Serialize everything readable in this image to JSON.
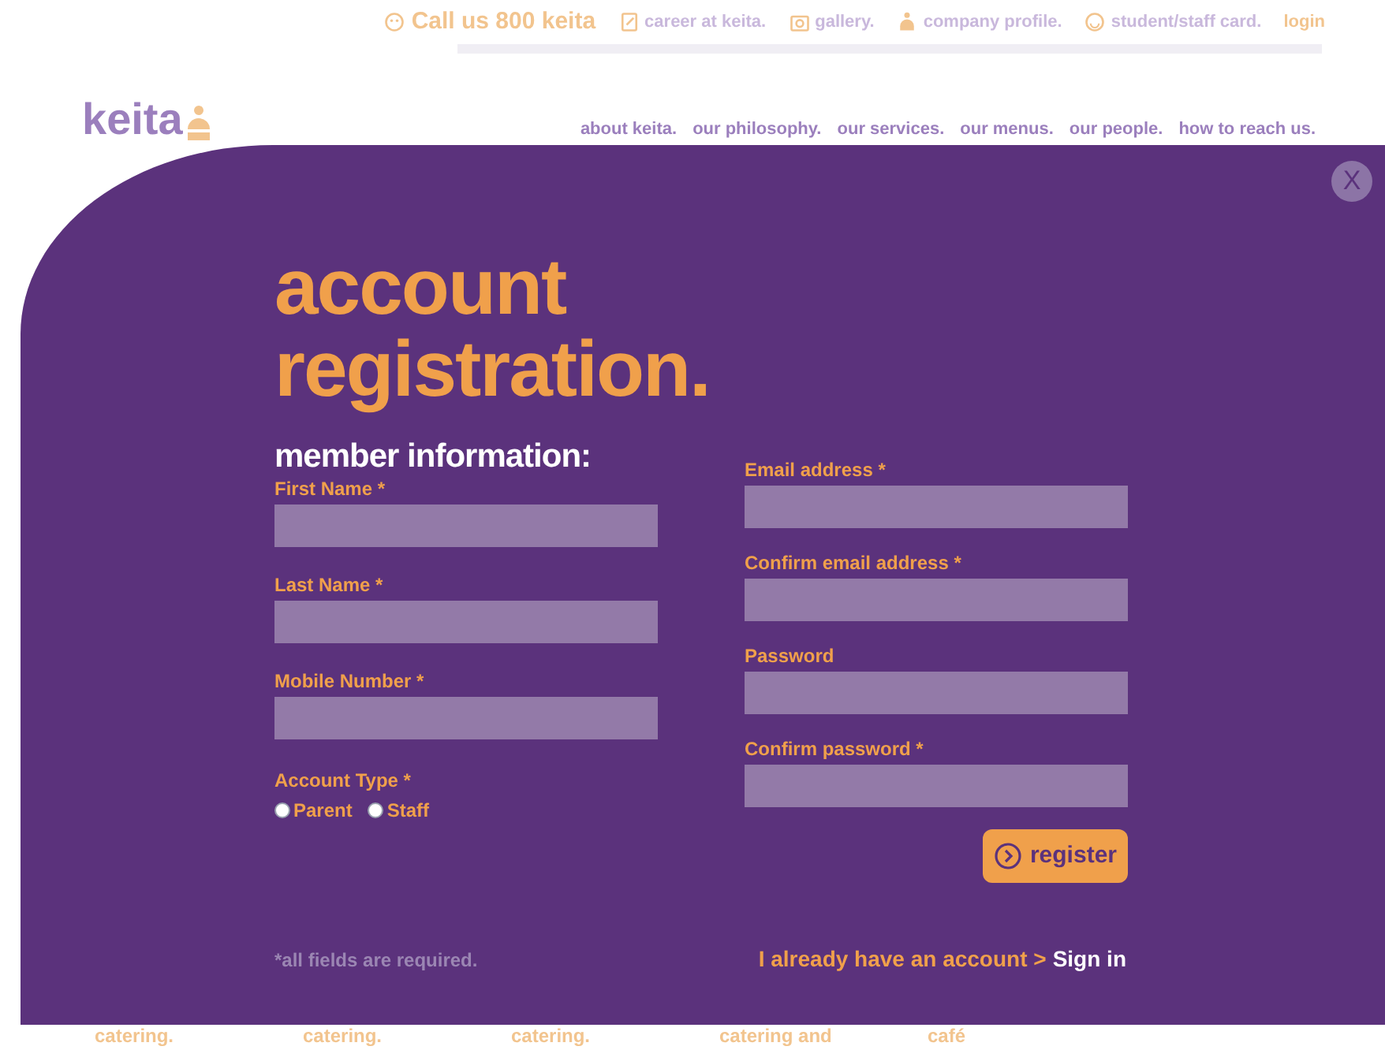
{
  "top_bar": {
    "phone": "Call us 800 keita",
    "links": [
      {
        "label": "career at keita."
      },
      {
        "label": "gallery."
      },
      {
        "label": "company profile."
      },
      {
        "label": "student/staff card."
      }
    ],
    "login": "login"
  },
  "logo": "keita",
  "nav": [
    "about keita.",
    "our philosophy.",
    "our services.",
    "our menus.",
    "our people.",
    "how to reach us."
  ],
  "modal": {
    "close": "X",
    "title_lines": [
      "account",
      "registration."
    ],
    "section_title": "member information:",
    "left_fields": [
      {
        "label": "First Name *"
      },
      {
        "label": "Last Name *"
      },
      {
        "label": "Mobile Number *"
      }
    ],
    "account_type": {
      "label": "Account Type *",
      "options": [
        {
          "label": "Parent",
          "selected": false
        },
        {
          "label": "Staff",
          "selected": false
        }
      ]
    },
    "right_fields": [
      {
        "label": "Email address *"
      },
      {
        "label": "Confirm email address *"
      },
      {
        "label": "Password"
      },
      {
        "label": "Confirm password *"
      }
    ],
    "register": "register",
    "required_note": "*all fields are required.",
    "signin_prompt": "I already have an account >",
    "signin_link": "Sign in"
  },
  "bottom_links": [
    "catering.",
    "catering.",
    "catering.",
    "catering and",
    "café"
  ]
}
